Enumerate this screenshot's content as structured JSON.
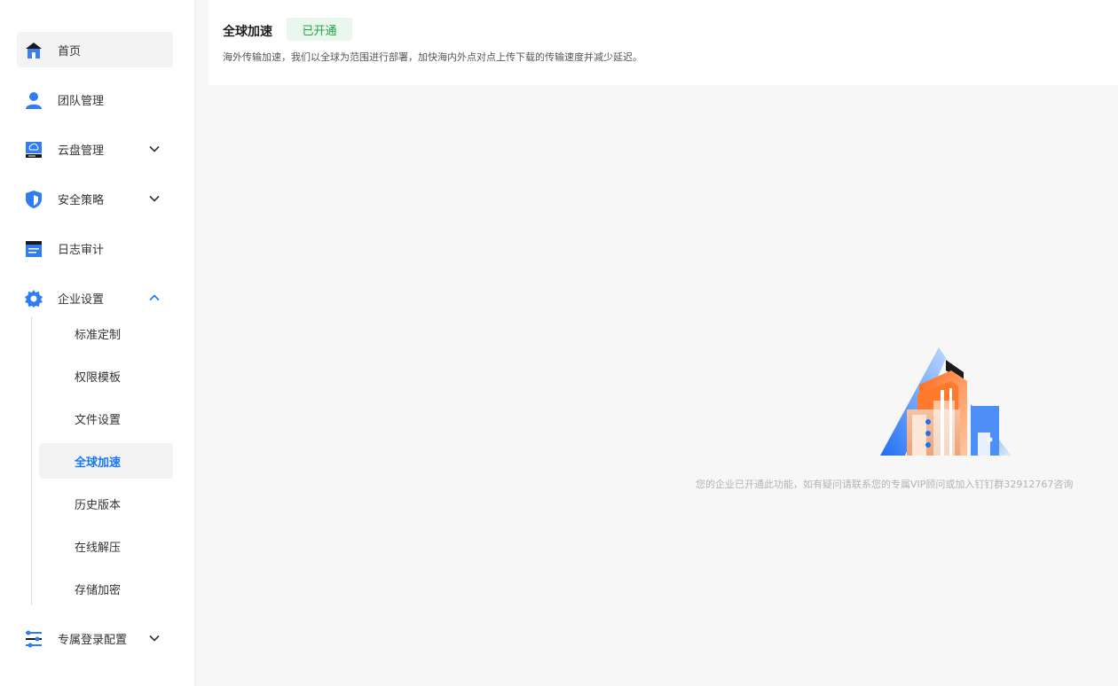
{
  "sidebar": {
    "items": [
      {
        "label": "首页",
        "icon": "home-icon"
      },
      {
        "label": "团队管理",
        "icon": "user-icon"
      },
      {
        "label": "云盘管理",
        "icon": "cloud-disk-icon"
      },
      {
        "label": "安全策略",
        "icon": "shield-icon"
      },
      {
        "label": "日志审计",
        "icon": "log-icon"
      },
      {
        "label": "企业设置",
        "icon": "gear-icon"
      },
      {
        "label": "专属登录配置",
        "icon": "sliders-icon"
      }
    ],
    "sub_items": [
      {
        "label": "标准定制"
      },
      {
        "label": "权限模板"
      },
      {
        "label": "文件设置"
      },
      {
        "label": "全球加速"
      },
      {
        "label": "历史版本"
      },
      {
        "label": "在线解压"
      },
      {
        "label": "存储加密"
      }
    ]
  },
  "header": {
    "title": "全球加速",
    "status": "已开通",
    "description": "海外传输加速，我们以全球为范围进行部署，加快海内外点对点上传下载的传输速度并减少延迟。"
  },
  "main": {
    "notice": "您的企业已开通此功能，如有疑问请联系您的专属VIP顾问或加入钉钉群32912767咨询"
  },
  "colors": {
    "accent": "#1677ff",
    "status_green": "#23a443",
    "status_bg": "#e9f7ed"
  }
}
